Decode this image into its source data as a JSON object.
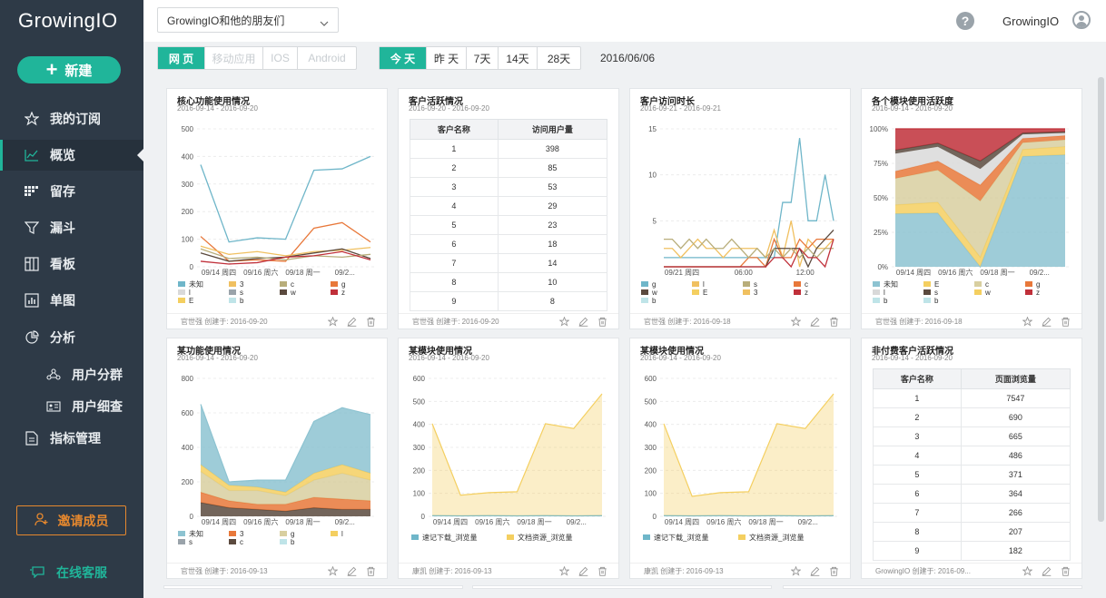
{
  "app": {
    "logo": "GrowingIO"
  },
  "sidebar": {
    "new_label": "新建",
    "items": [
      {
        "label": "我的订阅",
        "icon": "star-icon"
      },
      {
        "label": "概览",
        "icon": "line-chart-icon"
      },
      {
        "label": "留存",
        "icon": "retention-icon"
      },
      {
        "label": "漏斗",
        "icon": "funnel-icon"
      },
      {
        "label": "看板",
        "icon": "board-icon"
      },
      {
        "label": "单图",
        "icon": "bar-chart-icon"
      },
      {
        "label": "分析",
        "icon": "pie-icon"
      },
      {
        "label": "用户分群",
        "icon": "user-group-icon"
      },
      {
        "label": "用户细查",
        "icon": "user-card-icon"
      },
      {
        "label": "指标管理",
        "icon": "document-icon"
      }
    ],
    "invite_label": "邀请成员",
    "support_label": "在线客服"
  },
  "topbar": {
    "project": "GrowingIO和他的朋友们",
    "user": "GrowingIO",
    "help": "?"
  },
  "filters": {
    "platforms": [
      "网 页",
      "移动应用",
      "IOS",
      "Android"
    ],
    "ranges": [
      "今 天",
      "昨 天",
      "7天",
      "14天",
      "28天"
    ],
    "date": "2016/06/06"
  },
  "colors": {
    "accent": "#20b59a",
    "invite": "#e6882e",
    "sidebar": "#2e3a47"
  },
  "cards": [
    {
      "title": "核心功能使用情况",
      "date": "2016-09-14 - 2016-09-20",
      "footer": "官世强 创建于: 2016-09-20",
      "chart_data": {
        "type": "line",
        "x": [
          "09/14 周四",
          "09/16 周六",
          "09/18 周一",
          "09/2..."
        ],
        "yticks": [
          0,
          100,
          200,
          300,
          400,
          500
        ],
        "ylim": [
          0,
          500
        ],
        "series": [
          {
            "name": "未知",
            "color": "#6fb6c9",
            "values": [
              370,
              90,
              105,
              100,
              350,
              355,
              400
            ]
          },
          {
            "name": "g",
            "color": "#e8783a",
            "values": [
              110,
              20,
              25,
              20,
              140,
              160,
              90
            ]
          },
          {
            "name": "3",
            "color": "#f0c060",
            "values": [
              75,
              45,
              55,
              40,
              55,
              60,
              70
            ]
          },
          {
            "name": "w",
            "color": "#5b4a3e",
            "values": [
              50,
              20,
              30,
              35,
              50,
              65,
              30
            ]
          },
          {
            "name": "c",
            "color": "#b8ad7a",
            "values": [
              65,
              30,
              35,
              25,
              40,
              35,
              45
            ]
          },
          {
            "name": "z",
            "color": "#c0303a",
            "values": [
              20,
              10,
              15,
              35,
              40,
              55,
              25
            ]
          }
        ],
        "legend": [
          "未知",
          "3",
          "c",
          "g",
          "l",
          "s",
          "w",
          "z",
          "E",
          "b"
        ]
      }
    },
    {
      "title": "客户活跃情况",
      "date": "2016-09-20 - 2016-09-20",
      "footer": "官世强 创建于: 2016-09-20",
      "chart_data": {
        "type": "table",
        "headers": [
          "客户名称",
          "访问用户量"
        ],
        "rows": [
          [
            "1",
            "398"
          ],
          [
            "2",
            "85"
          ],
          [
            "3",
            "53"
          ],
          [
            "4",
            "29"
          ],
          [
            "5",
            "23"
          ],
          [
            "6",
            "18"
          ],
          [
            "7",
            "14"
          ],
          [
            "8",
            "10"
          ],
          [
            "9",
            "8"
          ]
        ]
      }
    },
    {
      "title": "客户访问时长",
      "date": "2016-09-21 - 2016-09-21",
      "footer": "官世强 创建于: 2016-09-18",
      "chart_data": {
        "type": "line",
        "x": [
          "09/21 周四",
          "06:00",
          "12:00"
        ],
        "yticks": [
          5,
          10,
          15
        ],
        "ylim": [
          0,
          15
        ],
        "series": [
          {
            "name": "g",
            "color": "#6fb6c9",
            "values": [
              1,
              1,
              1,
              1,
              1,
              1,
              1,
              1,
              1,
              1,
              1,
              1,
              1,
              1,
              7,
              7,
              14,
              5,
              5,
              10,
              5
            ]
          },
          {
            "name": "l",
            "color": "#f0c060",
            "values": [
              2,
              2,
              1,
              2,
              3,
              2,
              2,
              1,
              2,
              2,
              2,
              2,
              1,
              4,
              1,
              5,
              0,
              3,
              2,
              2,
              3
            ]
          },
          {
            "name": "c",
            "color": "#e8783a",
            "values": [
              0,
              0,
              0,
              0,
              0,
              0,
              0,
              0,
              0,
              0,
              1,
              1,
              0,
              3,
              1,
              1,
              3,
              2,
              3,
              3,
              3
            ]
          },
          {
            "name": "w",
            "color": "#5b4a3e",
            "values": [
              0,
              0,
              0,
              0,
              0,
              0,
              0,
              0,
              0,
              0,
              0,
              0,
              0,
              2,
              2,
              2,
              2,
              0,
              2,
              3,
              4
            ]
          },
          {
            "name": "s",
            "color": "#b8ad7a",
            "values": [
              3,
              3,
              2,
              3,
              2,
              3,
              2,
              2,
              3,
              2,
              1,
              2,
              1,
              2,
              1,
              2,
              1,
              2,
              1,
              2,
              2
            ]
          },
          {
            "name": "z",
            "color": "#c0303a",
            "values": [
              0,
              0,
              0,
              0,
              0,
              0,
              0,
              0,
              0,
              0,
              0,
              0,
              0,
              1,
              1,
              0,
              2,
              1,
              1,
              0,
              3
            ]
          }
        ],
        "legend": [
          "g",
          "l",
          "s",
          "c",
          "w",
          "E",
          "3",
          "z",
          "b"
        ]
      }
    },
    {
      "title": "各个模块使用活跃度",
      "date": "2016-09-14 - 2016-09-20",
      "footer": "官世强 创建于: 2016-09-18",
      "chart_data": {
        "type": "area",
        "x": [
          "09/14 周四",
          "09/16 周六",
          "09/18 周一",
          "09/2..."
        ],
        "yticks": [
          "0%",
          "25%",
          "50%",
          "75%",
          "100%"
        ],
        "ylim": [
          0,
          1
        ],
        "series": [
          {
            "name": "未知",
            "color": "#8dc3d1",
            "values": [
              0.3,
              0.3,
              0.0,
              0.8,
              0.82
            ]
          },
          {
            "name": "E",
            "color": "#f4cf60",
            "values": [
              0.05,
              0.06,
              0.06,
              0.05,
              0.06
            ]
          },
          {
            "name": "c",
            "color": "#d8cfa0",
            "values": [
              0.15,
              0.18,
              0.35,
              0.05,
              0.05
            ]
          },
          {
            "name": "g",
            "color": "#e8783a",
            "values": [
              0.04,
              0.05,
              0.1,
              0.03,
              0.03
            ]
          },
          {
            "name": "l",
            "color": "#d9d9d9",
            "values": [
              0.1,
              0.08,
              0.1,
              0.03,
              0.02
            ]
          },
          {
            "name": "s",
            "color": "#5b4a3e",
            "values": [
              0.02,
              0.02,
              0.05,
              0.01,
              0.01
            ]
          },
          {
            "name": "z",
            "color": "#c0303a",
            "values": [
              0.12,
              0.08,
              0.2,
              0.03,
              0.02
            ]
          }
        ],
        "legend": [
          "未知",
          "E",
          "c",
          "g",
          "l",
          "s",
          "w",
          "z",
          "b",
          "b"
        ]
      }
    },
    {
      "title": "某功能使用情况",
      "date": "2016-09-14 - 2016-09-20",
      "footer": "官世强 创建于: 2016-09-13",
      "chart_data": {
        "type": "area",
        "x": [
          "09/14 周四",
          "09/16 周六",
          "09/18 周一",
          "09/2..."
        ],
        "yticks": [
          0,
          200,
          400,
          600,
          800
        ],
        "ylim": [
          0,
          800
        ],
        "series": [
          {
            "name": "c",
            "color": "#5b4a3e",
            "values": [
              80,
              50,
              40,
              30,
              50,
              40,
              40
            ]
          },
          {
            "name": "3",
            "color": "#e8783a",
            "values": [
              60,
              40,
              30,
              40,
              60,
              60,
              50
            ]
          },
          {
            "name": "g",
            "color": "#d8cfa0",
            "values": [
              120,
              60,
              80,
              50,
              100,
              150,
              120
            ]
          },
          {
            "name": "l",
            "color": "#f4cf60",
            "values": [
              40,
              30,
              20,
              20,
              40,
              50,
              40
            ]
          },
          {
            "name": "未知",
            "color": "#8dc3d1",
            "values": [
              350,
              20,
              40,
              70,
              300,
              330,
              340
            ]
          }
        ],
        "legend": [
          "未知",
          "3",
          "g",
          "l",
          "s",
          "c",
          "b"
        ]
      }
    },
    {
      "title": "某模块使用情况",
      "date": "2016-09-14 - 2016-09-20",
      "footer": "康凯 创建于: 2016-09-13",
      "chart_data": {
        "type": "area",
        "x": [
          "09/14 周四",
          "09/16 周六",
          "09/18 周一",
          "09/2..."
        ],
        "yticks": [
          0,
          100,
          200,
          300,
          400,
          500,
          600
        ],
        "ylim": [
          0,
          600
        ],
        "series": [
          {
            "name": "速记下载_浏览量",
            "color": "#6fb6c9",
            "values": [
              3,
              2,
              3,
              2,
              3,
              2,
              3
            ]
          },
          {
            "name": "文档资源_浏览量",
            "color": "#f4cf60",
            "values": [
              400,
              90,
              100,
              105,
              400,
              380,
              530
            ]
          }
        ],
        "legend": [
          "速记下载_浏览量",
          "文档资源_浏览量"
        ]
      }
    },
    {
      "title": "某模块使用情况",
      "date": "2016-09-14 - 2016-09-20",
      "footer": "康凯 创建于: 2016-09-13",
      "chart_data": {
        "type": "area",
        "x": [
          "09/14 周四",
          "09/16 周六",
          "09/18 周一",
          "09/2..."
        ],
        "yticks": [
          0,
          100,
          200,
          300,
          400,
          500,
          600
        ],
        "ylim": [
          0,
          600
        ],
        "series": [
          {
            "name": "速记下载_浏览量",
            "color": "#6fb6c9",
            "values": [
              3,
              2,
              3,
              2,
              3,
              2,
              3
            ]
          },
          {
            "name": "文档资源_浏览量",
            "color": "#f4cf60",
            "values": [
              400,
              85,
              100,
              105,
              400,
              380,
              530
            ]
          }
        ],
        "legend": [
          "速记下载_浏览量",
          "文档资源_浏览量"
        ]
      }
    },
    {
      "title": "非付费客户活跃情况",
      "date": "2016-09-14 - 2016-09-20",
      "footer": "GrowingIO 创建于: 2016-09...",
      "chart_data": {
        "type": "table",
        "headers": [
          "客户名称",
          "页面浏览量"
        ],
        "rows": [
          [
            "1",
            "7547"
          ],
          [
            "2",
            "690"
          ],
          [
            "3",
            "665"
          ],
          [
            "4",
            "486"
          ],
          [
            "5",
            "371"
          ],
          [
            "6",
            "364"
          ],
          [
            "7",
            "266"
          ],
          [
            "8",
            "207"
          ],
          [
            "9",
            "182"
          ]
        ]
      }
    }
  ]
}
